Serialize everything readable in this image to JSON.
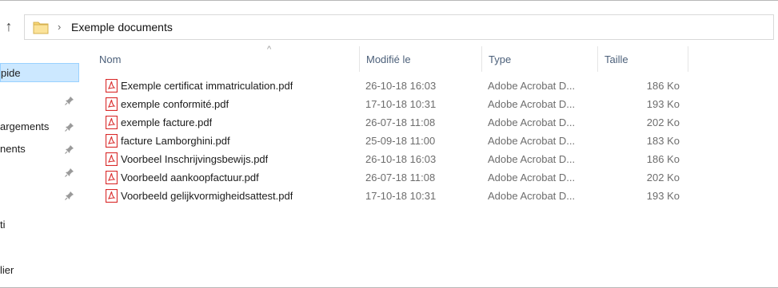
{
  "address_bar": {
    "separator": "›",
    "breadcrumb": "Exemple documents",
    "up_icon": "↑"
  },
  "nav": {
    "items": [
      {
        "label": "pide",
        "pinned": false,
        "selected": true
      },
      {
        "label": "",
        "pinned": true,
        "selected": false
      },
      {
        "label": "argements",
        "pinned": true,
        "selected": false
      },
      {
        "label": "nents",
        "pinned": true,
        "selected": false
      },
      {
        "label": "",
        "pinned": true,
        "selected": false
      },
      {
        "label": "",
        "pinned": true,
        "selected": false
      },
      {
        "label": "ti",
        "pinned": false,
        "selected": false
      },
      {
        "label": "lier",
        "pinned": false,
        "selected": false
      }
    ],
    "pin_icon": "📌"
  },
  "columns": {
    "name": "Nom",
    "modified": "Modifié le",
    "type": "Type",
    "size": "Taille",
    "sort_indicator": "^"
  },
  "files": [
    {
      "name": "Exemple certificat immatriculation.pdf",
      "modified": "26-10-18 16:03",
      "type": "Adobe Acrobat D...",
      "size": "186 Ko"
    },
    {
      "name": "exemple conformité.pdf",
      "modified": "17-10-18 10:31",
      "type": "Adobe Acrobat D...",
      "size": "193 Ko"
    },
    {
      "name": "exemple facture.pdf",
      "modified": "26-07-18 11:08",
      "type": "Adobe Acrobat D...",
      "size": "202 Ko"
    },
    {
      "name": "facture Lamborghini.pdf",
      "modified": "25-09-18 11:00",
      "type": "Adobe Acrobat D...",
      "size": "183 Ko"
    },
    {
      "name": "Voorbeel Inschrijvingsbewijs.pdf",
      "modified": "26-10-18 16:03",
      "type": "Adobe Acrobat D...",
      "size": "186 Ko"
    },
    {
      "name": "Voorbeeld aankoopfactuur.pdf",
      "modified": "26-07-18 11:08",
      "type": "Adobe Acrobat D...",
      "size": "202 Ko"
    },
    {
      "name": "Voorbeeld gelijkvormigheidsattest.pdf",
      "modified": "17-10-18 10:31",
      "type": "Adobe Acrobat D...",
      "size": "193 Ko"
    }
  ],
  "colors": {
    "header_text": "#4c607a",
    "selected_bg": "#cce8ff",
    "pdf_red": "#d92b2b",
    "folder_yellow": "#f8d775"
  },
  "icons": {
    "folder": "folder-icon",
    "pdf": "pdf-file-icon",
    "pin": "pin-icon",
    "up": "up-arrow-icon"
  }
}
